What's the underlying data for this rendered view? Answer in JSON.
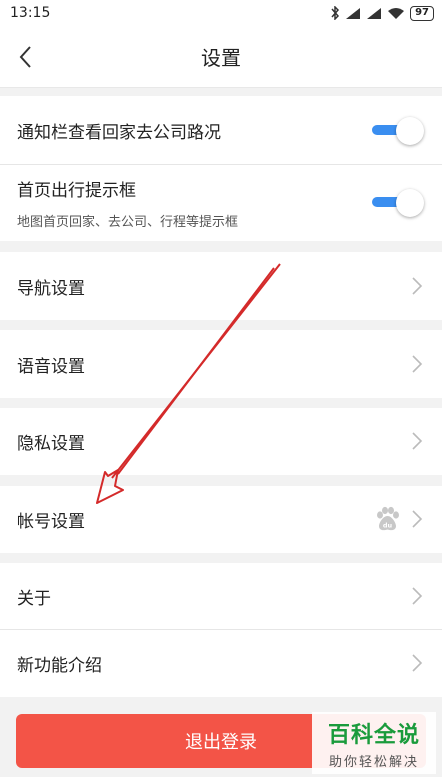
{
  "status_bar": {
    "time": "13:15",
    "icons": [
      "bluetooth-icon",
      "signal-icon",
      "signal-icon",
      "wifi-icon"
    ],
    "battery": "97"
  },
  "header": {
    "title": "设置",
    "back_icon": "chevron-left-icon"
  },
  "settings": {
    "notify_route": {
      "label": "通知栏查看回家去公司路况",
      "enabled": true
    },
    "home_tip": {
      "label": "首页出行提示框",
      "sub": "地图首页回家、去公司、行程等提示框",
      "enabled": true
    },
    "navigation": {
      "label": "导航设置"
    },
    "voice": {
      "label": "语音设置"
    },
    "privacy": {
      "label": "隐私设置"
    },
    "account": {
      "label": "帐号设置",
      "icon": "baidu-paw-icon"
    },
    "about": {
      "label": "关于"
    },
    "new_features": {
      "label": "新功能介绍"
    }
  },
  "logout": {
    "label": "退出登录"
  },
  "watermark": {
    "title": "百科全说",
    "sub": "助你轻松解决"
  },
  "colors": {
    "toggle_on": "#3a8ef0",
    "logout_bg": "#f35447",
    "annotation_arrow": "#d42a2a",
    "watermark_green": "#1a9b3c"
  }
}
